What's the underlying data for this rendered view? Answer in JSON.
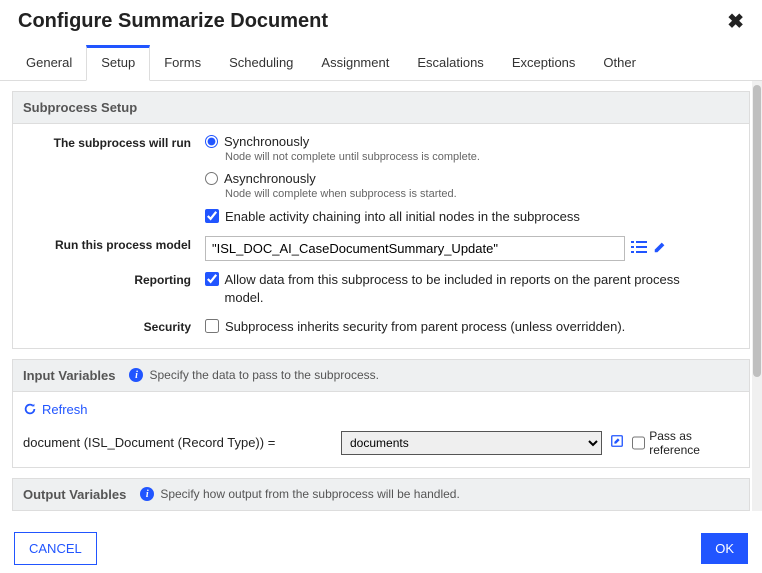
{
  "dialog": {
    "title": "Configure Summarize Document"
  },
  "tabs": [
    "General",
    "Setup",
    "Forms",
    "Scheduling",
    "Assignment",
    "Escalations",
    "Exceptions",
    "Other"
  ],
  "active_tab": "Setup",
  "sections": {
    "subprocess_setup": {
      "title": "Subprocess Setup",
      "run_label": "The subprocess will run",
      "sync_label": "Synchronously",
      "sync_hint": "Node will not complete until subprocess is complete.",
      "async_label": "Asynchronously",
      "async_hint": "Node will complete when subprocess is started.",
      "chaining_label": "Enable activity chaining into all initial nodes in the subprocess",
      "pm_label": "Run this process model",
      "pm_value": "\"ISL_DOC_AI_CaseDocumentSummary_Update\"",
      "reporting_label": "Reporting",
      "reporting_text": "Allow data from this subprocess to be included in reports on the parent process model.",
      "security_label": "Security",
      "security_text": "Subprocess inherits security from parent process (unless overridden)."
    },
    "input_vars": {
      "title": "Input Variables",
      "hint": "Specify the data to pass to the subprocess.",
      "refresh": "Refresh",
      "var_label": "document (ISL_Document (Record Type)) =",
      "var_value": "documents",
      "pass_ref": "Pass as reference"
    },
    "output_vars": {
      "title": "Output Variables",
      "hint": "Specify how output from the subprocess will be handled."
    }
  },
  "footer": {
    "cancel": "CANCEL",
    "ok": "OK"
  }
}
